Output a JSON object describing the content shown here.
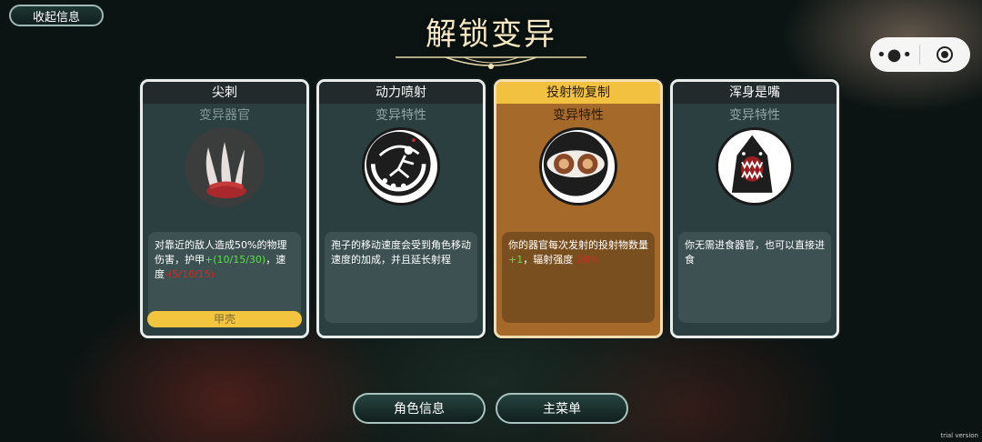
{
  "header": {
    "collapse_label": "收起信息",
    "title": "解锁变异"
  },
  "capsule": {
    "more_glyph": "•●•"
  },
  "cards": [
    {
      "name": "尖刺",
      "type": "变异器官",
      "icon": "claw-spikes-icon",
      "desc_main": "对靠近的敌人造成50%的物理伤害，护甲",
      "desc_plus": "+(10/15/30)",
      "desc_mid": "，速度",
      "desc_minus": "-(5/10/15)",
      "tag": "甲壳"
    },
    {
      "name": "动力喷射",
      "type": "变异特性",
      "icon": "jet-boost-icon",
      "desc_main": "孢子的移动速度会受到角色移动速度的加成，并且延长射程"
    },
    {
      "name": "投射物复制",
      "type": "变异特性",
      "icon": "projectile-duplicate-icon",
      "desc_main": "你的器官每次发射的投射物数量",
      "desc_plus": "+1",
      "desc_mid": "，辐射强度",
      "desc_minus": "-20%"
    },
    {
      "name": "浑身是嘴",
      "type": "变异特性",
      "icon": "shark-mouth-icon",
      "desc_main": "你无需进食器官，也可以直接进食"
    }
  ],
  "bottom": {
    "character_info": "角色信息",
    "main_menu": "主菜单"
  },
  "watermark": "trial version",
  "colors": {
    "selected_card": "#a56a2a",
    "header_highlight": "#f1c13f",
    "plus": "#58e04a",
    "minus": "#d22a22"
  }
}
